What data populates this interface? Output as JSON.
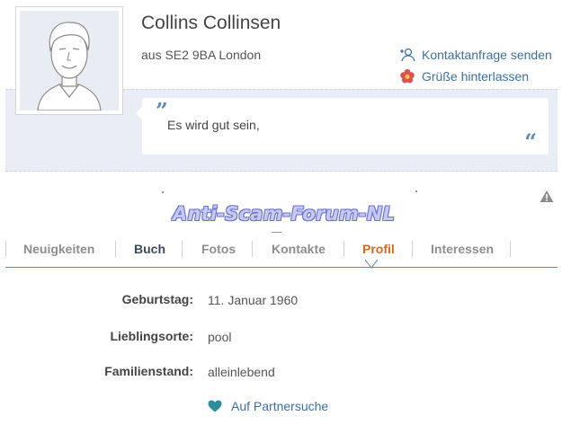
{
  "profile": {
    "name": "Collins Collinsen",
    "location": "aus SE2 9BA London",
    "status_quote": "Es wird gut sein,"
  },
  "actions": {
    "contact_request": "Kontaktanfrage senden",
    "leave_greeting": "Grüße hinterlassen"
  },
  "watermark": "Anti-Scam-Forum-NL",
  "tabs": [
    {
      "label": "Neuigkeiten"
    },
    {
      "label": "Buch"
    },
    {
      "label": "Fotos"
    },
    {
      "label": "Kontakte"
    },
    {
      "label": "Profil"
    },
    {
      "label": "Interessen"
    }
  ],
  "active_tab": "Profil",
  "details": [
    {
      "label": "Geburtstag:",
      "value": "11. Januar 1960"
    },
    {
      "label": "Lieblingsorte:",
      "value": "pool"
    },
    {
      "label": "Familienstand:",
      "value": "alleinlebend"
    }
  ],
  "partner_search": "Auf Partnersuche",
  "colors": {
    "link": "#3d6fa3",
    "active_tab": "#d2691e",
    "quote_band": "#e9eef6",
    "heart": "#2a8e9e",
    "flower": "#d9534f"
  }
}
